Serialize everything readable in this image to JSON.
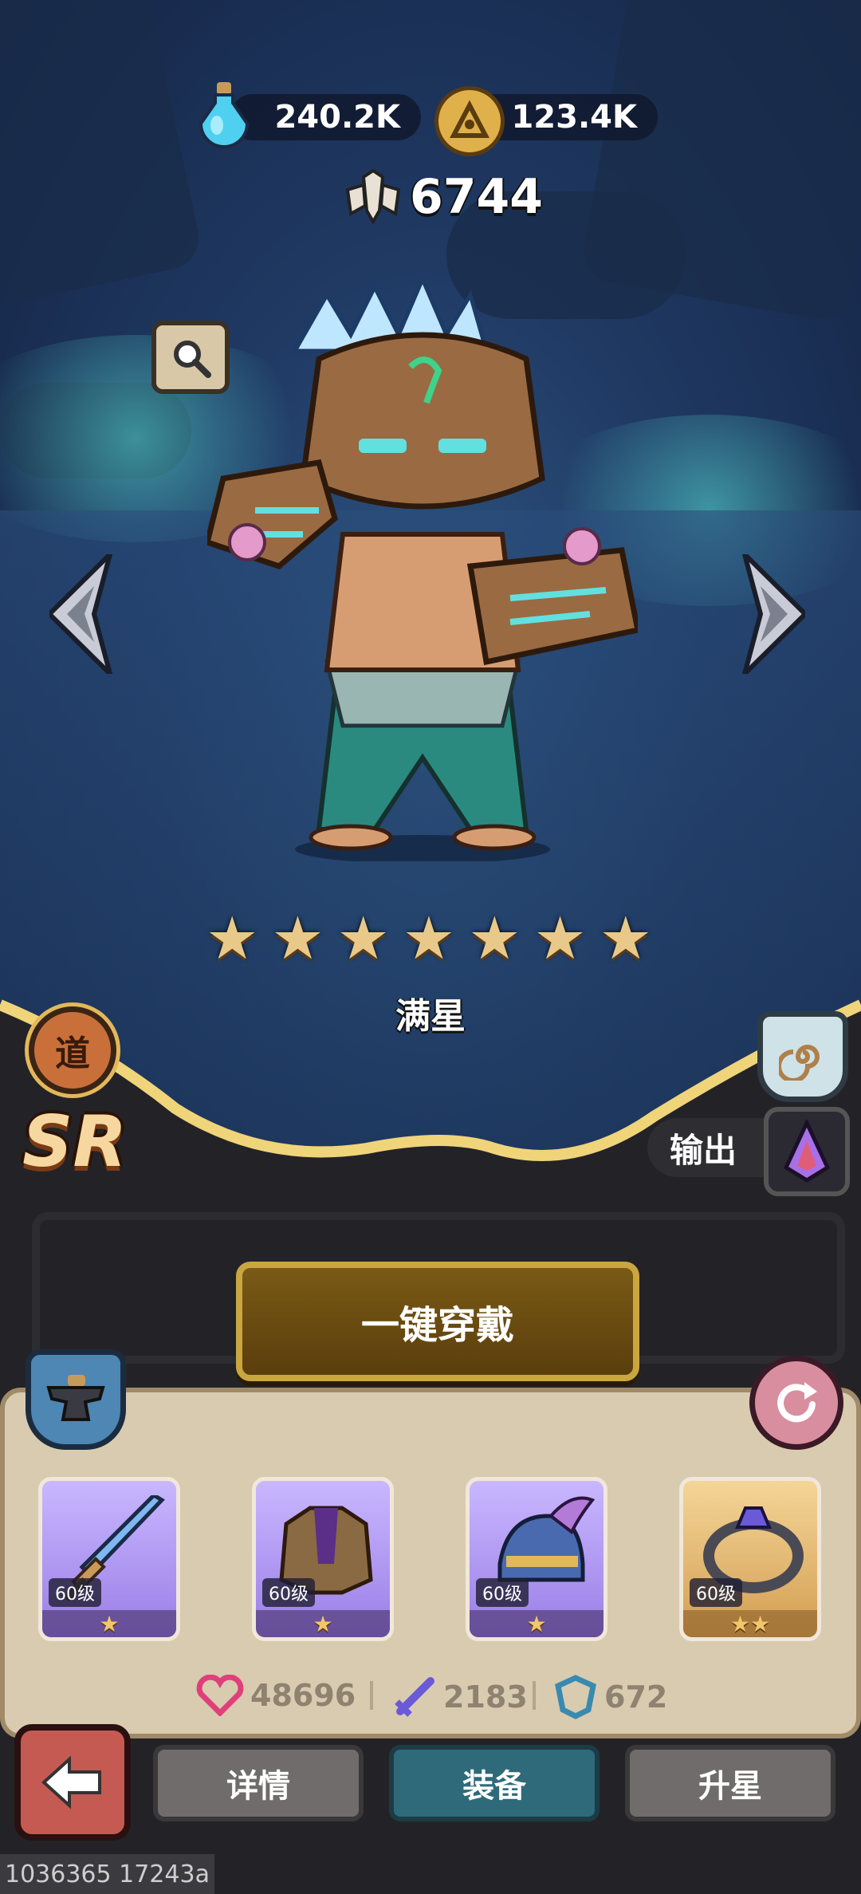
{
  "currencies": {
    "potion": {
      "value": "240.2K",
      "icon": "potion-icon"
    },
    "coin": {
      "value": "123.4K",
      "icon": "coin-icon"
    }
  },
  "power": {
    "value": "6744",
    "icon": "power-icon"
  },
  "hero": {
    "stars": 7,
    "star_label": "满星",
    "rarity": "SR",
    "faction_badge": "道",
    "role_label": "输出"
  },
  "actions": {
    "one_click_equip": "一键穿戴"
  },
  "equipment": [
    {
      "name": "sword",
      "level": "60级",
      "stars": "★",
      "frame": "purple"
    },
    {
      "name": "armor",
      "level": "60级",
      "stars": "★",
      "frame": "purple"
    },
    {
      "name": "helmet",
      "level": "60级",
      "stars": "★",
      "frame": "purple"
    },
    {
      "name": "ring",
      "level": "60级",
      "stars": "★★",
      "frame": "gold"
    }
  ],
  "stats": {
    "hp": "48696",
    "attack": "2183",
    "defense": "672"
  },
  "tabs": [
    "详情",
    "装备",
    "升星"
  ],
  "active_tab": "装备",
  "footer_id": "1036365 17243a",
  "colors": {
    "accent_gold": "#c9a640",
    "active_tab": "#2e6a7a",
    "star": "#e8c989"
  }
}
